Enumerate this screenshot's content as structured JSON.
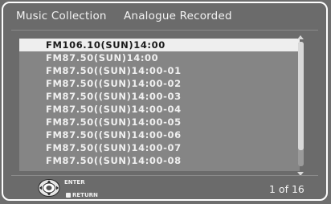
{
  "header": {
    "title": "Music Collection",
    "subtitle": "Analogue Recorded"
  },
  "list": {
    "items": [
      "FM106.10(SUN)14:00",
      "FM87.50(SUN)14:00",
      "FM87.50((SUN)14:00-01",
      "FM87.50((SUN)14:00-02",
      "FM87.50((SUN)14:00-03",
      "FM87.50((SUN)14:00-04",
      "FM87.50((SUN)14:00-05",
      "FM87.50((SUN)14:00-06",
      "FM87.50((SUN)14:00-07",
      "FM87.50((SUN)14:00-08"
    ],
    "selected_index": 0
  },
  "footer": {
    "enter_label": "ENTER",
    "return_label": "RETURN",
    "page_indicator": "1 of 16",
    "enter_icon": "remote-dpad-icon",
    "return_icon": "return-square-icon"
  },
  "colors": {
    "background": "#6b6b6b",
    "selected_row": "#eeeeee",
    "text": "#f0f0f0"
  }
}
